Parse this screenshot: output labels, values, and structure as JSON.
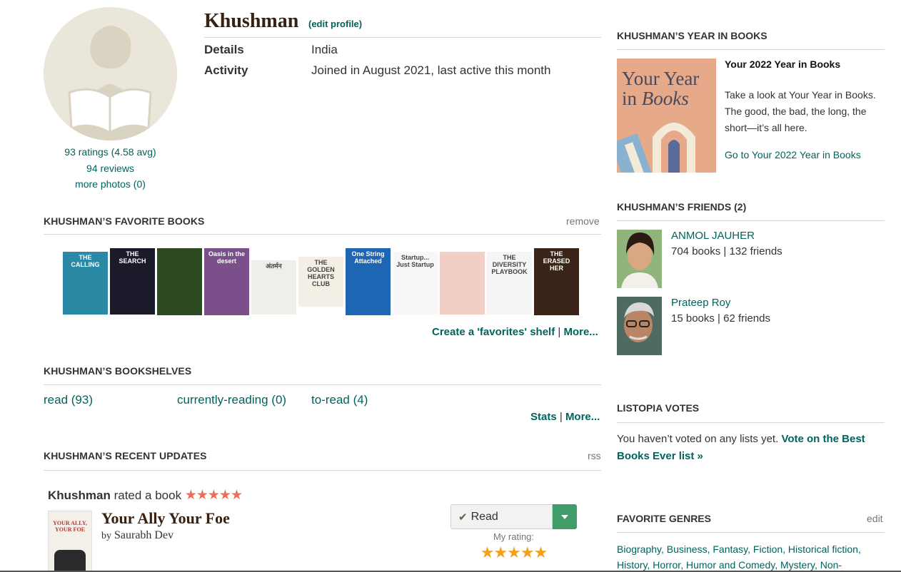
{
  "profile": {
    "name": "Khushman",
    "edit_label": "(edit profile)",
    "details_label": "Details",
    "details_value": "India",
    "activity_label": "Activity",
    "activity_value": "Joined in August 2021, last active this month",
    "ratings": "93 ratings (4.58 avg)",
    "reviews": "94 reviews",
    "photos": "more photos (0)"
  },
  "favorites": {
    "title": "KHUSHMAN’S FAVORITE BOOKS",
    "remove": "remove",
    "books": [
      {
        "cover_text": "THE CALLING",
        "color": "#2a8aa6"
      },
      {
        "cover_text": "THE SEARCH",
        "color": "#1a1a2a"
      },
      {
        "cover_text": "",
        "color": "#2d4a22"
      },
      {
        "cover_text": "Oasis in the desert",
        "color": "#7a4f8a"
      },
      {
        "cover_text": "अंतर्मन",
        "color": "#eeeeea"
      },
      {
        "cover_text": "THE GOLDEN HEARTS CLUB",
        "color": "#f3efe4"
      },
      {
        "cover_text": "One String Attached",
        "color": "#1e66b4"
      },
      {
        "cover_text": "Startup... Just Startup",
        "color": "#f7f7f7"
      },
      {
        "cover_text": "",
        "color": "#f1cfc4"
      },
      {
        "cover_text": "THE DIVERSITY PLAYBOOK",
        "color": "#f5f5f5"
      },
      {
        "cover_text": "THE ERASED HER",
        "color": "#3a2418"
      }
    ],
    "create_shelf": "Create a 'favorites' shelf",
    "separator": "|",
    "more": "More..."
  },
  "bookshelves": {
    "title": "KHUSHMAN’S BOOKSHELVES",
    "shelves": [
      "read (93)",
      "currently-reading (0)",
      "to-read (4)"
    ],
    "stats": "Stats",
    "separator": "|",
    "more": "More..."
  },
  "updates": {
    "title": "KHUSHMAN’S RECENT UPDATES",
    "rss": "rss",
    "user": "Khushman",
    "action": "rated a book",
    "stars": "★★★★★",
    "book_title": "Your Ally Your Foe",
    "by_label": "by",
    "author": "Saurabh Dev",
    "read_button": "Read",
    "my_rating_label": "My rating:",
    "my_rating_stars": "★★★★★",
    "cover_text": "YOUR ALLY, YOUR FOE"
  },
  "year_in_books": {
    "title": "KHUSHMAN’S YEAR IN BOOKS",
    "image_line1": "Your Year",
    "image_line2": "in",
    "image_line3": "Books",
    "heading": "Your 2022 Year in Books",
    "body": "Take a look at Your Year in Books. The good, the bad, the long, the short—it’s all here.",
    "link": "Go to Your 2022 Year in Books"
  },
  "friends": {
    "title": "KHUSHMAN’S FRIENDS (2)",
    "list": [
      {
        "name": "ANMOL JAUHER",
        "meta": "704 books | 132 friends"
      },
      {
        "name": "Prateep Roy",
        "meta": "15 books | 62 friends"
      }
    ]
  },
  "listopia": {
    "title": "LISTOPIA VOTES",
    "text": "You haven’t voted on any lists yet.",
    "link": "Vote on the Best Books Ever list »"
  },
  "genres": {
    "title": "FAVORITE GENRES",
    "edit": "edit",
    "line1": "Biography, Business, Fantasy, Fiction, Historical fiction,",
    "line2": "History, Horror, Humor and Comedy, Mystery, Non-"
  },
  "colors": {
    "link": "#00635d",
    "heading_brown": "#382110",
    "star_orange": "#e76f5b",
    "star_yellow": "#f2a11f",
    "read_green": "#409d69"
  }
}
